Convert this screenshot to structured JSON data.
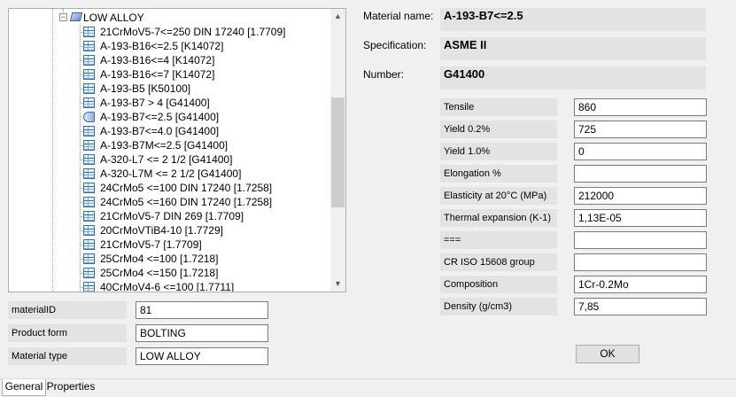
{
  "tree": {
    "group_label": "LOW ALLOY",
    "items": [
      {
        "label": "21CrMoV5-7<=250 DIN 17240  [1.7709]",
        "icon": "table-icon"
      },
      {
        "label": "A-193-B16<=2.5  [K14072]",
        "icon": "table-icon"
      },
      {
        "label": "A-193-B16<=4  [K14072]",
        "icon": "table-icon"
      },
      {
        "label": "A-193-B16<=7  [K14072]",
        "icon": "table-icon"
      },
      {
        "label": "A-193-B5  [K50100]",
        "icon": "table-icon"
      },
      {
        "label": "A-193-B7 > 4  [G41400]",
        "icon": "table-icon"
      },
      {
        "label": "A-193-B7<=2.5  [G41400]",
        "icon": "bolt-icon"
      },
      {
        "label": "A-193-B7<=4.0  [G41400]",
        "icon": "table-icon"
      },
      {
        "label": "A-193-B7M<=2.5  [G41400]",
        "icon": "table-icon"
      },
      {
        "label": "A-320-L7 <= 2 1/2  [G41400]",
        "icon": "table-icon"
      },
      {
        "label": "A-320-L7M <= 2 1/2  [G41400]",
        "icon": "table-icon"
      },
      {
        "label": "24CrMo5 <=100 DIN 17240  [1.7258]",
        "icon": "table-icon"
      },
      {
        "label": "24CrMo5 <=160 DIN 17240  [1.7258]",
        "icon": "table-icon"
      },
      {
        "label": "21CrMoV5-7 DIN 269  [1.7709]",
        "icon": "table-icon"
      },
      {
        "label": "20CrMoVTiB4-10  [1.7729]",
        "icon": "table-icon"
      },
      {
        "label": "21CrMoV5-7  [1.7709]",
        "icon": "table-icon"
      },
      {
        "label": "25CrMo4 <=100  [1.7218]",
        "icon": "table-icon"
      },
      {
        "label": "25CrMo4 <=150  [1.7218]",
        "icon": "table-icon"
      },
      {
        "label": "40CrMoV4-6 <=100  [1.7711]",
        "icon": "table-icon"
      }
    ]
  },
  "left_fields": [
    {
      "label": "materialID",
      "value": "81"
    },
    {
      "label": "Product form",
      "value": "BOLTING"
    },
    {
      "label": "Material type",
      "value": "LOW ALLOY"
    }
  ],
  "header_info": [
    {
      "label": "Material name:",
      "value": "A-193-B7<=2.5"
    },
    {
      "label": "Specification:",
      "value": "ASME II"
    },
    {
      "label": "Number:",
      "value": "G41400"
    }
  ],
  "properties": [
    {
      "label": "Tensile",
      "value": "860"
    },
    {
      "label": "Yield 0.2%",
      "value": "725"
    },
    {
      "label": "Yield 1.0%",
      "value": "0"
    },
    {
      "label": "Elongation %",
      "value": ""
    },
    {
      "label": "Elasticity at 20°C (MPa)",
      "value": "212000"
    },
    {
      "label": "Thermal expansion (K-1)",
      "value": "1,13E-05"
    },
    {
      "label": "===",
      "value": ""
    },
    {
      "label": "CR ISO 15608 group",
      "value": ""
    },
    {
      "label": "Composition",
      "value": "1Cr-0.2Mo"
    },
    {
      "label": "Density (g/cm3)",
      "value": "7,85"
    }
  ],
  "ok_label": "OK",
  "tabs": [
    {
      "label": "General",
      "active": true
    },
    {
      "label": "Properties",
      "active": false
    }
  ]
}
